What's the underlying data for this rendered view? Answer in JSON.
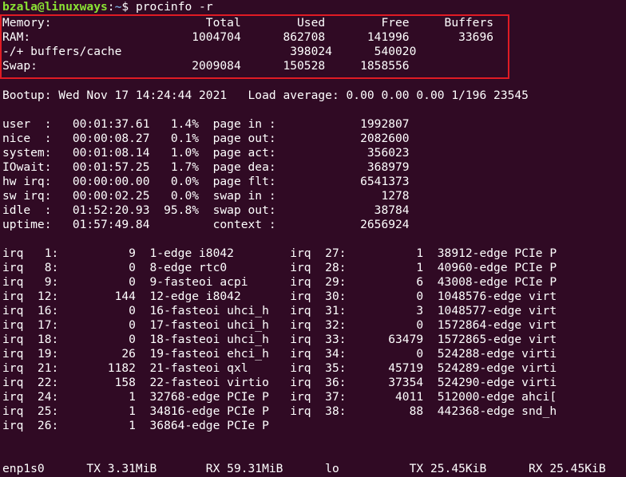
{
  "window": {
    "background": "#300a24",
    "text_color": "#ffffff",
    "highlight_color": "#e01b24"
  },
  "prompt": {
    "user_host": "bzala@linuxways",
    "colon": ":",
    "path": "~",
    "symbol": "$",
    "command": " procinfo -r"
  },
  "memory": {
    "header": "Memory:                      Total        Used        Free     Buffers",
    "ram": "RAM:                       1004704      862708      141996       33696",
    "buffers_cache": "-/+ buffers/cache                        398024      540020",
    "swap": "Swap:                      2009084      150528     1858556"
  },
  "bootup": "Bootup: Wed Nov 17 14:24:44 2021   Load average: 0.00 0.00 0.00 1/196 23545",
  "cpu_stats": [
    "user  :   00:01:37.61   1.4%  page in :            1992807",
    "nice  :   00:00:08.27   0.1%  page out:            2082600",
    "system:   00:01:08.14   1.0%  page act:             356023",
    "IOwait:   00:01:57.25   1.7%  page dea:             368979",
    "hw irq:   00:00:00.00   0.0%  page flt:            6541373",
    "sw irq:   00:00:02.25   0.0%  swap in :               1278",
    "idle  :   01:52:20.93  95.8%  swap out:              38784",
    "uptime:   01:57:49.84         context :            2656924"
  ],
  "irq_lines": [
    "irq   1:          9  1-edge i8042        irq  27:          1  38912-edge PCIe P",
    "irq   8:          0  8-edge rtc0         irq  28:          1  40960-edge PCIe P",
    "irq   9:          0  9-fasteoi acpi      irq  29:          6  43008-edge PCIe P",
    "irq  12:        144  12-edge i8042       irq  30:          0  1048576-edge virt",
    "irq  16:          0  16-fasteoi uhci_h   irq  31:          3  1048577-edge virt",
    "irq  17:          0  17-fasteoi uhci_h   irq  32:          0  1572864-edge virt",
    "irq  18:          0  18-fasteoi uhci_h   irq  33:      63479  1572865-edge virt",
    "irq  19:         26  19-fasteoi ehci_h   irq  34:          0  524288-edge virti",
    "irq  21:       1182  21-fasteoi qxl      irq  35:      45719  524289-edge virti",
    "irq  22:        158  22-fasteoi virtio   irq  36:      37354  524290-edge virti",
    "irq  24:          1  32768-edge PCIe P   irq  37:       4011  512000-edge ahci[",
    "irq  25:          1  34816-edge PCIe P   irq  38:         88  442368-edge snd_h",
    "irq  26:          1  36864-edge PCIe P"
  ],
  "network": "enp1s0      TX 3.31MiB       RX 59.31MiB      lo          TX 25.45KiB      RX 25.45KiB"
}
